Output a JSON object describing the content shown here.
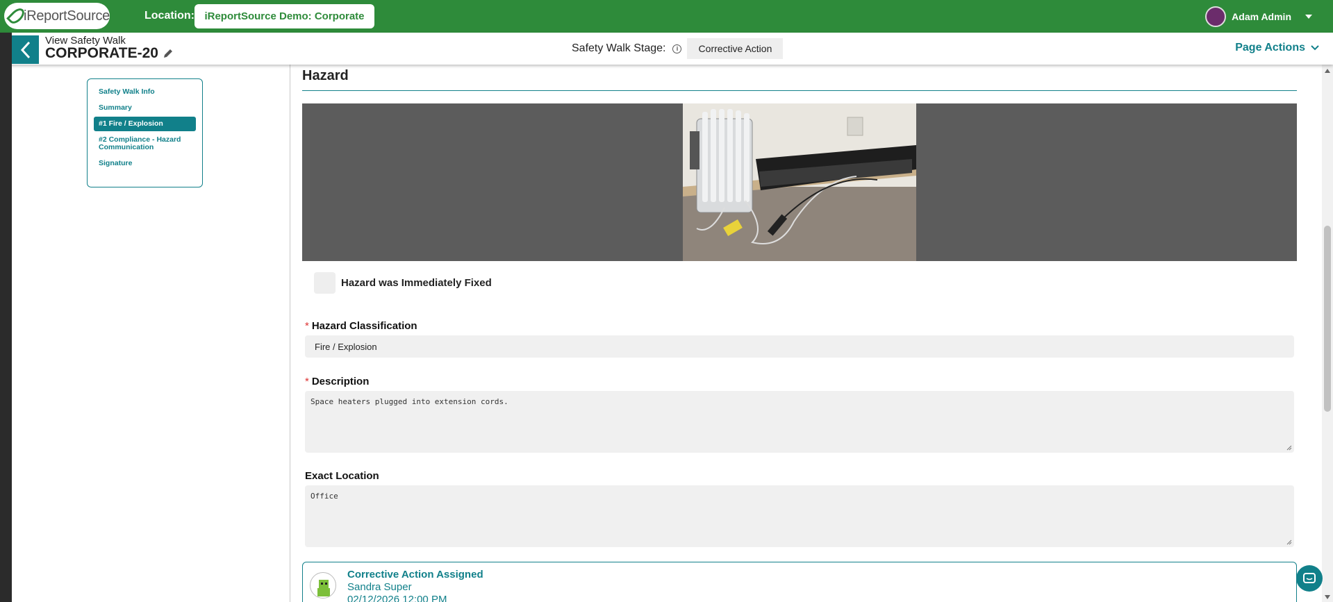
{
  "topbar": {
    "logo_text": "iReportSource",
    "location_label": "Location:",
    "location_value": "iReportSource Demo: Corporate",
    "user_name": "Adam Admin"
  },
  "subheader": {
    "title_small": "View Safety Walk",
    "title_large": "CORPORATE-20",
    "stage_label": "Safety Walk Stage:",
    "stage_value": "Corrective Action",
    "page_actions": "Page Actions"
  },
  "sidenav": {
    "items": [
      {
        "label": "Safety Walk Info"
      },
      {
        "label": "Summary"
      },
      {
        "label": "#1 Fire / Explosion"
      },
      {
        "label": "#2 Compliance - Hazard Communication"
      },
      {
        "label": "Signature"
      }
    ]
  },
  "hazard": {
    "section_title": "Hazard",
    "immediately_fixed_label": "Hazard was Immediately Fixed",
    "classification_label": "Hazard Classification",
    "classification_value": "Fire / Explosion",
    "description_label": "Description",
    "description_value": "Space heaters plugged into extension cords.",
    "location_label": "Exact Location",
    "location_value": "Office"
  },
  "corrective_action": {
    "title": "Corrective Action Assigned",
    "assignee": "Sandra Super",
    "date": "02/12/2026 12:00 PM"
  },
  "colors": {
    "brand_green": "#2e8b3a",
    "teal": "#11808a",
    "required": "#dd3333"
  }
}
